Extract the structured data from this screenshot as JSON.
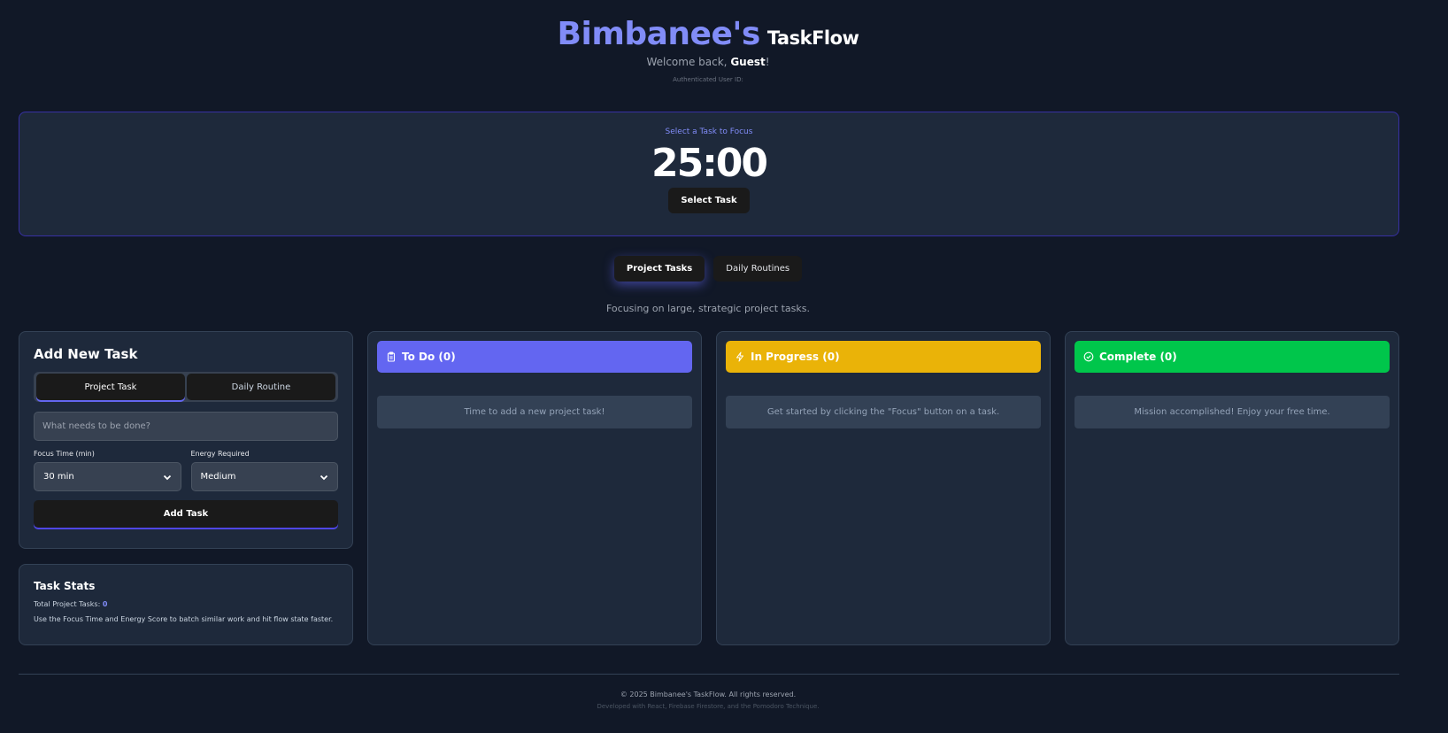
{
  "header": {
    "brand": "Bimbanee's",
    "app_name": "TaskFlow",
    "welcome_prefix": "Welcome back, ",
    "user_name": "Guest",
    "welcome_suffix": "!",
    "auth_label": "Authenticated User ID:"
  },
  "focus": {
    "label": "Select a Task to Focus",
    "timer": "25:00",
    "button": "Select Task"
  },
  "tabs": [
    {
      "label": "Project Tasks",
      "active": true
    },
    {
      "label": "Daily Routines",
      "active": false
    }
  ],
  "tab_description": "Focusing on large, strategic project tasks.",
  "add_task": {
    "title": "Add New Task",
    "type_options": [
      "Project Task",
      "Daily Routine"
    ],
    "placeholder": "What needs to be done?",
    "focus_time_label": "Focus Time (min)",
    "focus_time_value": "30 min",
    "energy_label": "Energy Required",
    "energy_value": "Medium",
    "submit": "Add Task"
  },
  "stats": {
    "title": "Task Stats",
    "total_label": "Total Project Tasks: ",
    "total_count": "0",
    "tip": "Use the Focus Time and Energy Score to batch similar work and hit flow state faster."
  },
  "columns": [
    {
      "title": "To Do (0)",
      "empty": "Time to add a new project task!",
      "color": "#6366f1",
      "icon": "clipboard-icon"
    },
    {
      "title": "In Progress (0)",
      "empty": "Get started by clicking the \"Focus\" button on a task.",
      "color": "#eab308",
      "icon": "lightning-icon"
    },
    {
      "title": "Complete (0)",
      "empty": "Mission accomplished! Enjoy your free time.",
      "color": "#00c64b",
      "icon": "check-circle-icon"
    }
  ],
  "footer": {
    "copyright": "© 2025 Bimbanee's TaskFlow. All rights reserved.",
    "developed": "Developed with React, Firebase Firestore, and the Pomodoro Technique."
  }
}
